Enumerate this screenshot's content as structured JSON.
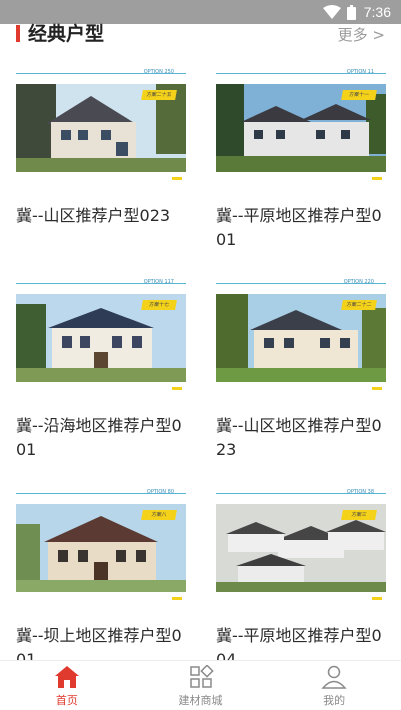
{
  "status_bar": {
    "time": "7:36"
  },
  "section": {
    "title": "经典户型",
    "more_label": "更多 >"
  },
  "colors": {
    "accent": "#e0392d",
    "tag_yellow": "#f5d21a",
    "line_blue": "#5ab4d6"
  },
  "cards": [
    {
      "code": "OPTION 250",
      "tag": "方案二十五",
      "name": "冀--山区推荐户型023"
    },
    {
      "code": "OPTION 11",
      "tag": "方案十一",
      "name": "冀--平原地区推荐户型001"
    },
    {
      "code": "OPTION 117",
      "tag": "方案十七",
      "name": "冀--沿海地区推荐户型001"
    },
    {
      "code": "OPTION 220",
      "tag": "方案二十二",
      "name": "冀--山区地区推荐户型023"
    },
    {
      "code": "OPTION 80",
      "tag": "方案八",
      "name": "冀--坝上地区推荐户型001"
    },
    {
      "code": "OPTION 38",
      "tag": "方案三",
      "name": "冀--平原地区推荐户型004"
    }
  ],
  "tabbar": {
    "items": [
      {
        "label": "首页",
        "icon": "home-icon",
        "active": true
      },
      {
        "label": "建材商城",
        "icon": "grid-icon",
        "active": false
      },
      {
        "label": "我的",
        "icon": "user-icon",
        "active": false
      }
    ]
  }
}
